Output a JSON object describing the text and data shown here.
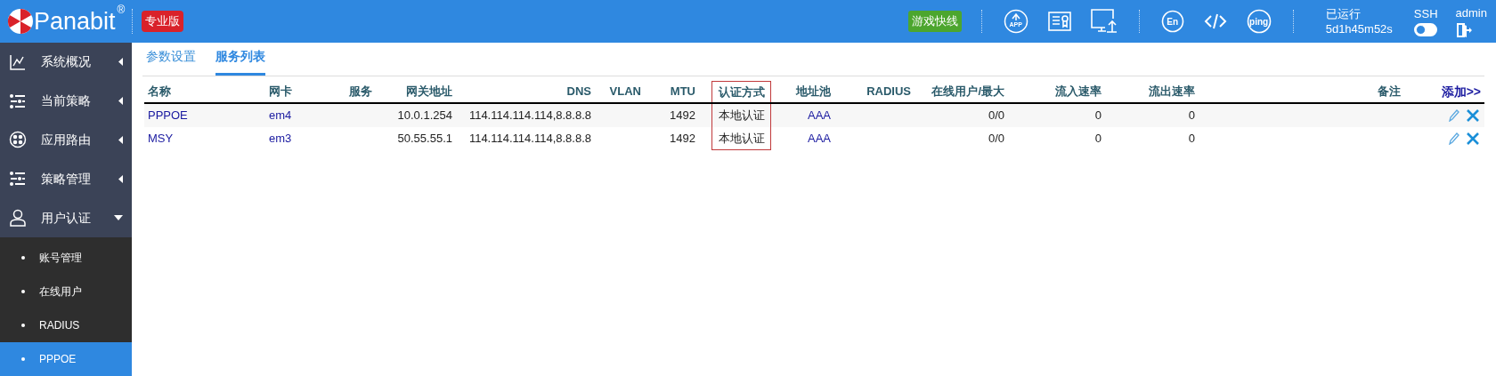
{
  "header": {
    "brand": "Panabit",
    "registered": "®",
    "edition": "专业版",
    "quick_badge": "游戏快线",
    "tools": [
      {
        "kind": "app",
        "label": "APP"
      },
      {
        "kind": "certificate"
      },
      {
        "kind": "monitor"
      },
      {
        "kind": "language",
        "label": "En"
      },
      {
        "kind": "code"
      },
      {
        "kind": "ping",
        "label": "ping"
      }
    ],
    "uptime": {
      "label": "已运行",
      "value": "5d1h45m52s"
    },
    "ssh": {
      "label": "SSH",
      "on": false
    },
    "user": {
      "name": "admin"
    }
  },
  "sidebar": {
    "items": [
      {
        "kind": "chart",
        "label": "系统概况",
        "expanded": false
      },
      {
        "kind": "sliders",
        "label": "当前策略",
        "expanded": false
      },
      {
        "kind": "route",
        "label": "应用路由",
        "expanded": false
      },
      {
        "kind": "sliders",
        "label": "策略管理",
        "expanded": false
      },
      {
        "kind": "user",
        "label": "用户认证",
        "expanded": true,
        "children": [
          {
            "label": "账号管理",
            "selected": false
          },
          {
            "label": "在线用户",
            "selected": false
          },
          {
            "label": "RADIUS",
            "selected": false
          },
          {
            "label": "PPPOE",
            "selected": true
          }
        ]
      }
    ]
  },
  "tabs": [
    {
      "label": "参数设置",
      "selected": false
    },
    {
      "label": "服务列表",
      "selected": true
    }
  ],
  "table": {
    "columns": [
      {
        "label": "名称",
        "highlighted": false
      },
      {
        "label": "网卡",
        "highlighted": false
      },
      {
        "label": "服务",
        "highlighted": false
      },
      {
        "label": "网关地址",
        "highlighted": false
      },
      {
        "label": "DNS",
        "highlighted": false
      },
      {
        "label": "VLAN",
        "highlighted": false
      },
      {
        "label": "MTU",
        "highlighted": false
      },
      {
        "label": "认证方式",
        "highlighted": true
      },
      {
        "label": "地址池",
        "highlighted": false
      },
      {
        "label": "RADIUS",
        "highlighted": false
      },
      {
        "label": "在线用户/最大",
        "highlighted": false
      },
      {
        "label": "流入速率",
        "highlighted": false
      },
      {
        "label": "流出速率",
        "highlighted": false
      },
      {
        "label": "备注",
        "highlighted": false
      }
    ],
    "add_link": "添加>>",
    "rows": [
      {
        "cells": [
          "PPPOE",
          "em4",
          "",
          "10.0.1.254",
          "114.114.114.114,8.8.8.8",
          "",
          "1492",
          "本地认证",
          "AAA",
          "",
          "0/0",
          "0",
          "0",
          ""
        ]
      },
      {
        "cells": [
          "MSY",
          "em3",
          "",
          "50.55.55.1",
          "114.114.114.114,8.8.8.8",
          "",
          "1492",
          "本地认证",
          "AAA",
          "",
          "0/0",
          "0",
          "0",
          ""
        ]
      }
    ]
  }
}
